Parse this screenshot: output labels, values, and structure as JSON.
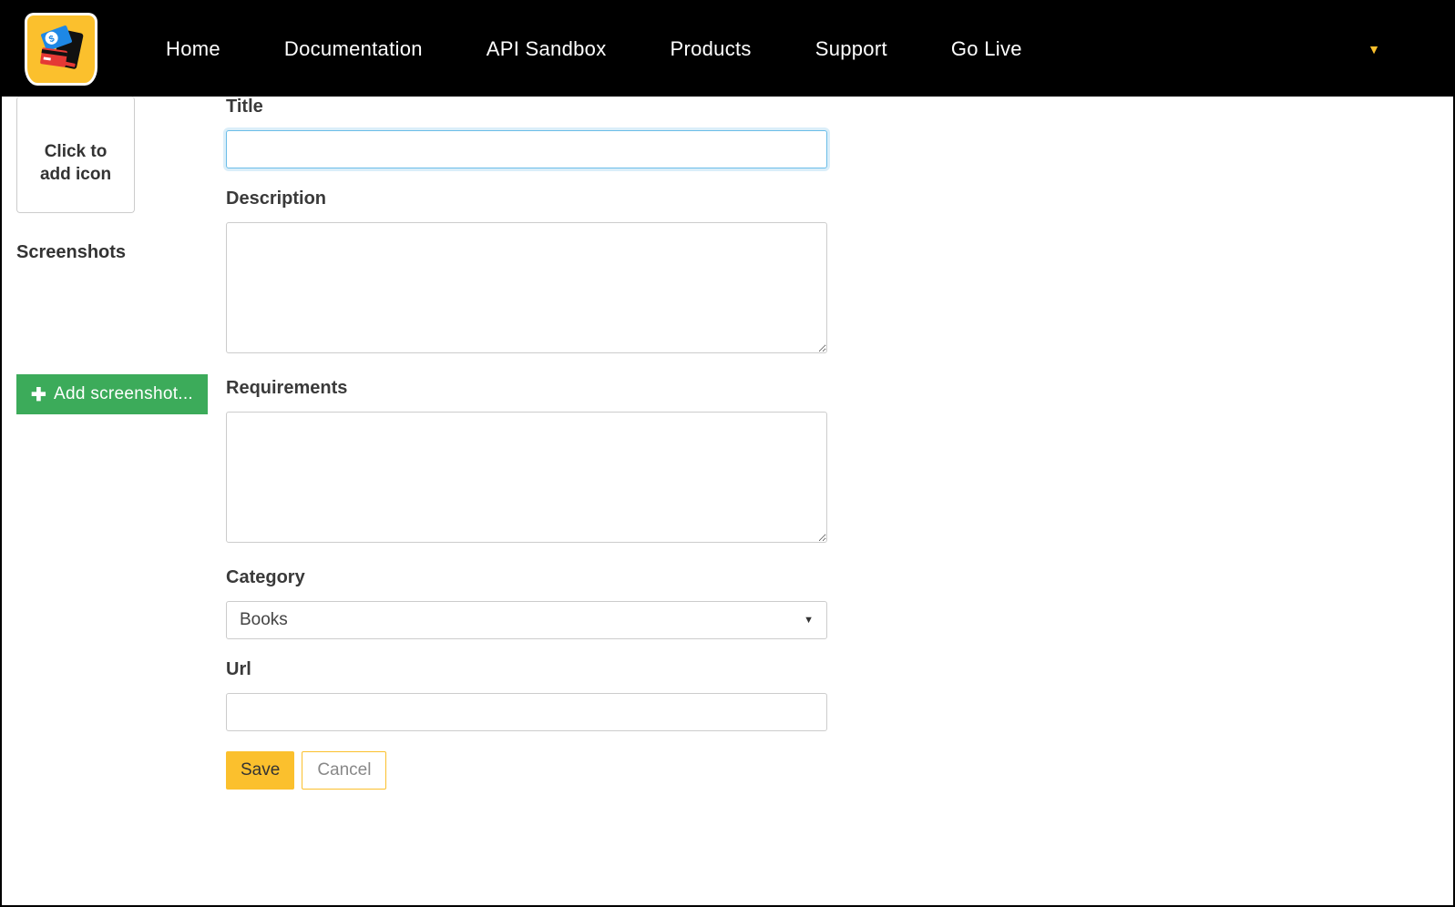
{
  "nav": {
    "items": [
      {
        "label": "Home"
      },
      {
        "label": "Documentation"
      },
      {
        "label": "API Sandbox"
      },
      {
        "label": "Products"
      },
      {
        "label": "Support"
      },
      {
        "label": "Go Live"
      }
    ]
  },
  "sidebar": {
    "icon_drop_label": "Click to add icon",
    "screenshots_label": "Screenshots",
    "add_screenshot_label": "Add screenshot..."
  },
  "form": {
    "title_label": "Title",
    "title_value": "",
    "description_label": "Description",
    "description_value": "",
    "requirements_label": "Requirements",
    "requirements_value": "",
    "category_label": "Category",
    "category_selected": "Books",
    "url_label": "Url",
    "url_value": "",
    "save_label": "Save",
    "cancel_label": "Cancel"
  }
}
